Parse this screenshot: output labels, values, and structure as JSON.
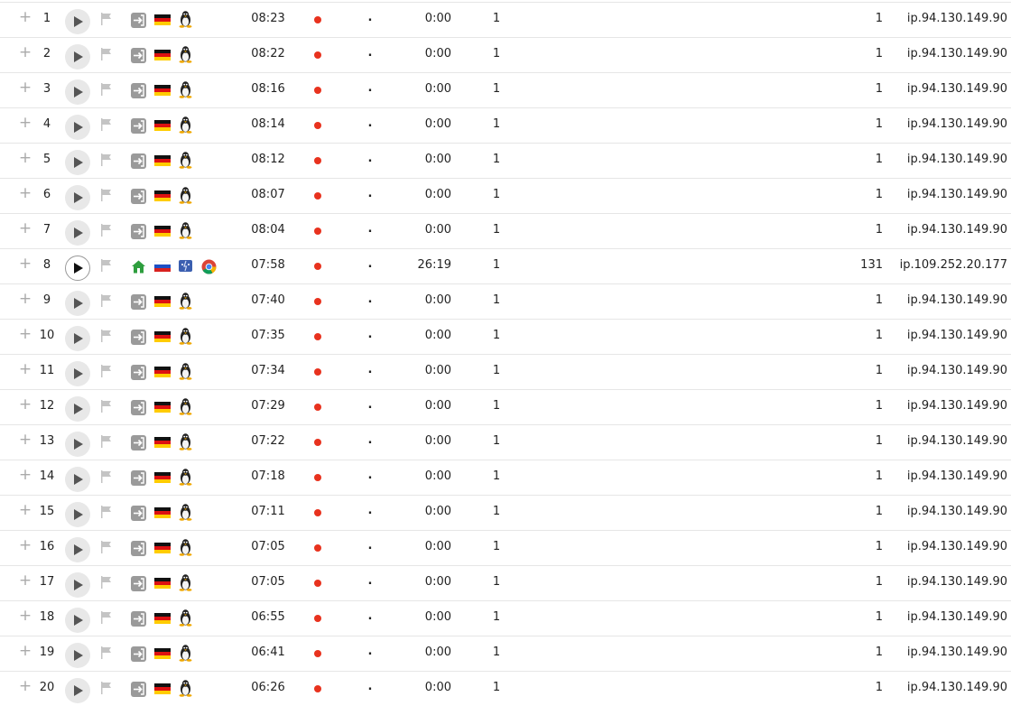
{
  "colors": {
    "status_dot": "#e8321e",
    "accent_home": "#2e9e3e"
  },
  "icons": {
    "expand": "plus-icon",
    "play": "play-icon",
    "flag": "flag-icon",
    "login": "login-arrow-icon",
    "home": "home-icon",
    "flag_de": "germany-flag-icon",
    "flag_ru": "russia-flag-icon",
    "linux": "linux-tux-icon",
    "macos": "macos-icon",
    "chrome": "chrome-icon"
  },
  "rows": [
    {
      "num": "1",
      "time": "08:23",
      "dotc": ".",
      "dur": "0:00",
      "c1": "1",
      "c2": "1",
      "ip": "ip.94.130.149.90",
      "type": "de"
    },
    {
      "num": "2",
      "time": "08:22",
      "dotc": ".",
      "dur": "0:00",
      "c1": "1",
      "c2": "1",
      "ip": "ip.94.130.149.90",
      "type": "de"
    },
    {
      "num": "3",
      "time": "08:16",
      "dotc": ".",
      "dur": "0:00",
      "c1": "1",
      "c2": "1",
      "ip": "ip.94.130.149.90",
      "type": "de"
    },
    {
      "num": "4",
      "time": "08:14",
      "dotc": ".",
      "dur": "0:00",
      "c1": "1",
      "c2": "1",
      "ip": "ip.94.130.149.90",
      "type": "de"
    },
    {
      "num": "5",
      "time": "08:12",
      "dotc": ".",
      "dur": "0:00",
      "c1": "1",
      "c2": "1",
      "ip": "ip.94.130.149.90",
      "type": "de"
    },
    {
      "num": "6",
      "time": "08:07",
      "dotc": ".",
      "dur": "0:00",
      "c1": "1",
      "c2": "1",
      "ip": "ip.94.130.149.90",
      "type": "de"
    },
    {
      "num": "7",
      "time": "08:04",
      "dotc": ".",
      "dur": "0:00",
      "c1": "1",
      "c2": "1",
      "ip": "ip.94.130.149.90",
      "type": "de"
    },
    {
      "num": "8",
      "time": "07:58",
      "dotc": ".",
      "dur": "26:19",
      "c1": "1",
      "c2": "131",
      "ip": "ip.109.252.20.177",
      "type": "ru"
    },
    {
      "num": "9",
      "time": "07:40",
      "dotc": ".",
      "dur": "0:00",
      "c1": "1",
      "c2": "1",
      "ip": "ip.94.130.149.90",
      "type": "de"
    },
    {
      "num": "10",
      "time": "07:35",
      "dotc": ".",
      "dur": "0:00",
      "c1": "1",
      "c2": "1",
      "ip": "ip.94.130.149.90",
      "type": "de"
    },
    {
      "num": "11",
      "time": "07:34",
      "dotc": ".",
      "dur": "0:00",
      "c1": "1",
      "c2": "1",
      "ip": "ip.94.130.149.90",
      "type": "de"
    },
    {
      "num": "12",
      "time": "07:29",
      "dotc": ".",
      "dur": "0:00",
      "c1": "1",
      "c2": "1",
      "ip": "ip.94.130.149.90",
      "type": "de"
    },
    {
      "num": "13",
      "time": "07:22",
      "dotc": ".",
      "dur": "0:00",
      "c1": "1",
      "c2": "1",
      "ip": "ip.94.130.149.90",
      "type": "de"
    },
    {
      "num": "14",
      "time": "07:18",
      "dotc": ".",
      "dur": "0:00",
      "c1": "1",
      "c2": "1",
      "ip": "ip.94.130.149.90",
      "type": "de"
    },
    {
      "num": "15",
      "time": "07:11",
      "dotc": ".",
      "dur": "0:00",
      "c1": "1",
      "c2": "1",
      "ip": "ip.94.130.149.90",
      "type": "de"
    },
    {
      "num": "16",
      "time": "07:05",
      "dotc": ".",
      "dur": "0:00",
      "c1": "1",
      "c2": "1",
      "ip": "ip.94.130.149.90",
      "type": "de"
    },
    {
      "num": "17",
      "time": "07:05",
      "dotc": ".",
      "dur": "0:00",
      "c1": "1",
      "c2": "1",
      "ip": "ip.94.130.149.90",
      "type": "de"
    },
    {
      "num": "18",
      "time": "06:55",
      "dotc": ".",
      "dur": "0:00",
      "c1": "1",
      "c2": "1",
      "ip": "ip.94.130.149.90",
      "type": "de"
    },
    {
      "num": "19",
      "time": "06:41",
      "dotc": ".",
      "dur": "0:00",
      "c1": "1",
      "c2": "1",
      "ip": "ip.94.130.149.90",
      "type": "de"
    },
    {
      "num": "20",
      "time": "06:26",
      "dotc": ".",
      "dur": "0:00",
      "c1": "1",
      "c2": "1",
      "ip": "ip.94.130.149.90",
      "type": "de"
    }
  ]
}
